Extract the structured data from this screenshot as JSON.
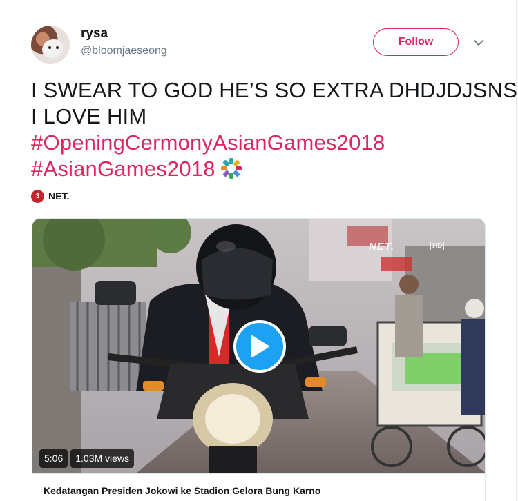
{
  "user": {
    "display_name": "rysa",
    "handle": "@bloomjaeseong"
  },
  "actions": {
    "follow_label": "Follow"
  },
  "tweet": {
    "line1": "I SWEAR TO GOD HE’S SO EXTRA DHDJDJSNS",
    "line2": "I LOVE HIM",
    "hashtag1": "#OpeningCermonyAsianGames2018",
    "hashtag2": "#AsianGames2018",
    "hashtag_color": "#e0245e"
  },
  "media": {
    "source_logo_text": "3",
    "source_name": "NET.",
    "watermark": "NET.",
    "watermark_hd": "HD",
    "duration": "5:06",
    "views": "1.03M views",
    "title": "Kedatangan Presiden Jokowi ke Stadion Gelora Bung Karno",
    "play_color": "#1da1f2"
  }
}
